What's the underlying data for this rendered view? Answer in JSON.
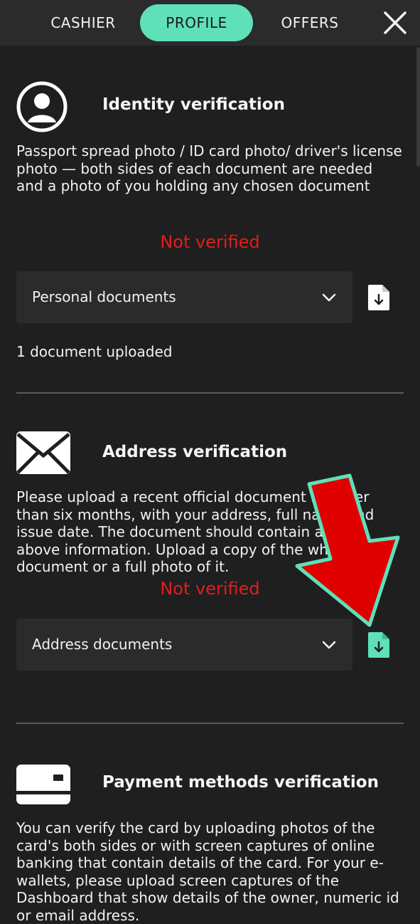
{
  "header": {
    "tabs": [
      {
        "label": "CASHIER",
        "active": false
      },
      {
        "label": "PROFILE",
        "active": true
      },
      {
        "label": "OFFERS",
        "active": false
      }
    ],
    "accent_color": "#5fe0b8"
  },
  "sections": [
    {
      "icon": "user-circle-icon",
      "title": "Identity verification",
      "description": "Passport spread photo / ID card photo/ driver's license photo — both sides of each document are needed and a photo of you holding any chosen document",
      "status": "Not verified",
      "dropdown_value": "Personal documents",
      "uploaded_text": "1 document uploaded"
    },
    {
      "icon": "envelope-icon",
      "title": "Address verification",
      "description": "Please upload a recent official document no older than six months, with your address, full name and issue date. The document should contain all the above information. Upload a copy of the whole document or a full photo of it.",
      "status": "Not verified",
      "dropdown_value": "Address documents"
    },
    {
      "icon": "credit-card-icon",
      "title": "Payment methods verification",
      "description": "You can verify the card by uploading photos of the card's both sides or with screen captures of online banking that contain details of the card. For your e-wallets, please upload screen captures of the Dashboard that show details of the owner, numeric id or email address."
    }
  ],
  "colors": {
    "status_red": "#e51c1c",
    "arrow_red": "#e00000"
  }
}
